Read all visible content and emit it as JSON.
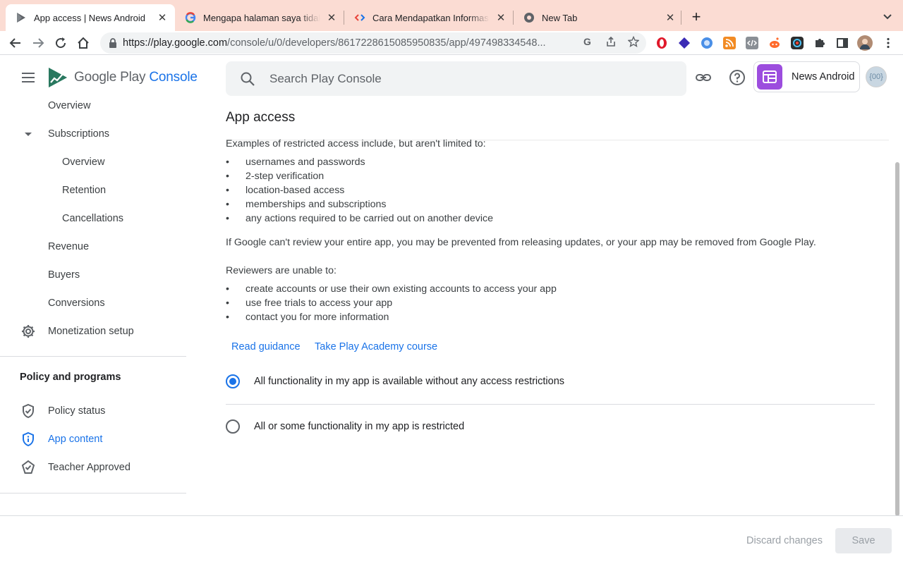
{
  "browser": {
    "tabs": [
      {
        "title": "App access | News Android",
        "active": true,
        "favicon": "play-console-icon"
      },
      {
        "title": "Mengapa halaman saya tidak m",
        "active": false,
        "favicon": "google-icon"
      },
      {
        "title": "Cara Mendapatkan Informasi di",
        "active": false,
        "favicon": "code-icon"
      },
      {
        "title": "New Tab",
        "active": false,
        "favicon": "chrome-icon"
      }
    ],
    "url_host": "https://play.google.com",
    "url_path": "/console/u/0/developers/8617228615085950835/app/497498334548..."
  },
  "header": {
    "logo_google": "Google Play",
    "logo_console": "Console",
    "search_placeholder": "Search Play Console",
    "app_name": "News Android",
    "avatar_text": "{00}"
  },
  "sidebar": {
    "items": [
      {
        "label": "Overview"
      },
      {
        "label": "Subscriptions"
      },
      {
        "label": "Overview"
      },
      {
        "label": "Retention"
      },
      {
        "label": "Cancellations"
      },
      {
        "label": "Revenue"
      },
      {
        "label": "Buyers"
      },
      {
        "label": "Conversions"
      },
      {
        "label": "Monetization setup"
      }
    ],
    "section_title": "Policy and programs",
    "policy_items": [
      {
        "label": "Policy status"
      },
      {
        "label": "App content",
        "active": true
      },
      {
        "label": "Teacher Approved"
      }
    ]
  },
  "main": {
    "title": "App access",
    "intro": "Examples of restricted access include, but aren't limited to:",
    "examples": [
      "usernames and passwords",
      "2-step verification",
      "location-based access",
      "memberships and subscriptions",
      "any actions required to be carried out on another device"
    ],
    "warning": "If Google can't review your entire app, you may be prevented from releasing updates, or your app may be removed from Google Play.",
    "reviewers_intro": "Reviewers are unable to:",
    "reviewers": [
      "create accounts or use their own existing accounts to access your app",
      "use free trials to access your app",
      "contact you for more information"
    ],
    "links": {
      "read_guidance": "Read guidance",
      "academy": "Take Play Academy course"
    },
    "options": [
      {
        "label": "All functionality in my app is available without any access restrictions",
        "selected": true
      },
      {
        "label": "All or some functionality in my app is restricted",
        "selected": false
      }
    ]
  },
  "footer": {
    "discard": "Discard changes",
    "save": "Save"
  },
  "colors": {
    "accent": "#1a73e8",
    "tabbar": "#fbdcd3",
    "app_icon": "#9c4dde"
  }
}
